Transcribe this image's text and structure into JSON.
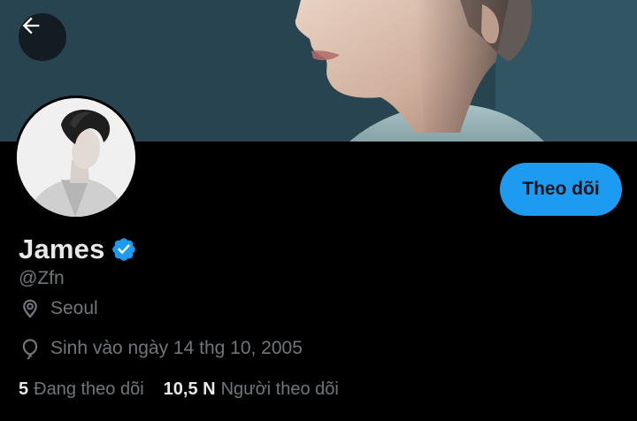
{
  "profile": {
    "display_name": "James",
    "handle": "@Zfn",
    "location": "Seoul",
    "birthday": "Sinh vào ngày 14 thg 10, 2005",
    "following_count": "5",
    "following_label": "Đang theo dõi",
    "followers_count": "10,5 N",
    "followers_label": "Người theo dõi",
    "verified": true
  },
  "actions": {
    "follow_label": "Theo dõi"
  },
  "icons": {
    "back": "arrow-left-icon",
    "verified": "verified-badge-icon",
    "location": "location-pin-icon",
    "birthday": "balloon-icon"
  },
  "colors": {
    "background": "#000000",
    "accent": "#1d9bf0",
    "primary_text": "#e7e9ea",
    "secondary_text": "#71767b"
  }
}
